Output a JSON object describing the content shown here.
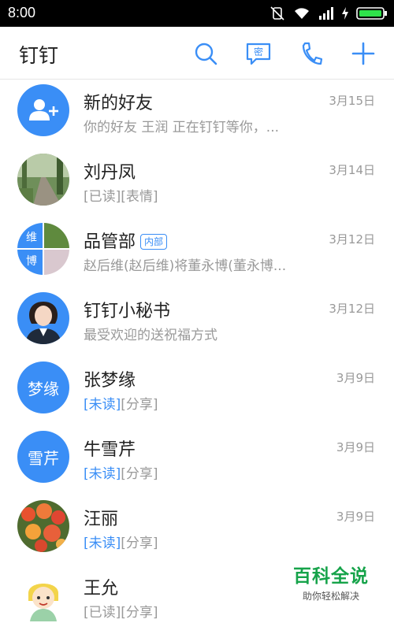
{
  "status_bar": {
    "time": "8:00"
  },
  "app": {
    "title": "钉钉",
    "secret_chat_label": "密",
    "accent": "#3a8ef6"
  },
  "conversations": [
    {
      "name": "新的好友",
      "time": "3月15日",
      "preview": "你的好友 王润 正在钉钉等你，...",
      "avatar_icon": "add-friend-icon"
    },
    {
      "name": "刘丹凤",
      "time": "3月14日",
      "preview": "[已读][表情]",
      "avatar_icon": "forest-path-photo"
    },
    {
      "name": "品管部",
      "tag": "内部",
      "time": "3月12日",
      "preview": "赵后维(赵后维)将董永博(董永博...",
      "avatar_tiles": [
        "维",
        "博"
      ]
    },
    {
      "name": "钉钉小秘书",
      "time": "3月12日",
      "preview": "最受欢迎的送祝福方式",
      "avatar_icon": "assistant-portrait"
    },
    {
      "name": "张梦缘",
      "time": "3月9日",
      "avatar_text": "梦缘",
      "status": "[未读]",
      "preview_suffix": "[分享]"
    },
    {
      "name": "牛雪芹",
      "time": "3月9日",
      "avatar_text": "雪芹",
      "status": "[未读]",
      "preview_suffix": "[分享]"
    },
    {
      "name": "汪丽",
      "time": "3月9日",
      "avatar_icon": "flowers-photo",
      "status": "[未读]",
      "preview_suffix": "[分享]"
    },
    {
      "name": "王允",
      "time": "",
      "avatar_icon": "cartoon-girl-illustration",
      "preview": "[已读][分享]"
    }
  ],
  "watermark": {
    "title": "百科全说",
    "subtitle": "助你轻松解决"
  }
}
